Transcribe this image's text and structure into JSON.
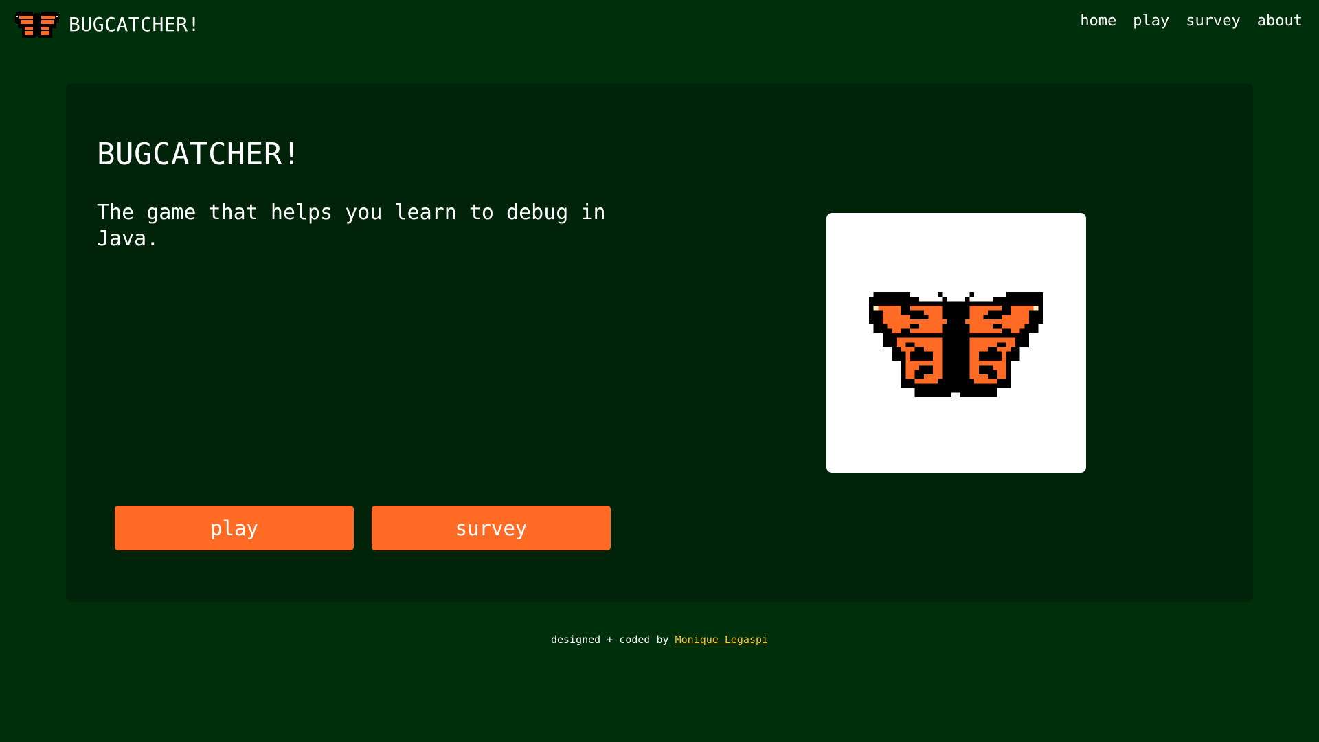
{
  "nav": {
    "brand": "BUGCATCHER!",
    "links": [
      "home",
      "play",
      "survey",
      "about"
    ]
  },
  "hero": {
    "title": "BUGCATCHER!",
    "tagline": "The game that helps you learn to debug in Java.",
    "buttons": {
      "play": "play",
      "survey": "survey"
    },
    "image_icon": "pixel-butterfly-icon"
  },
  "footer": {
    "prefix": "designed + coded by ",
    "author": "Monique Legaspi"
  },
  "colors": {
    "page_background": "#00300b",
    "card_background": "#00230a",
    "accent_orange": "#ff6a24",
    "link_yellow": "#f9c63a",
    "image_card": "#ffffff"
  }
}
